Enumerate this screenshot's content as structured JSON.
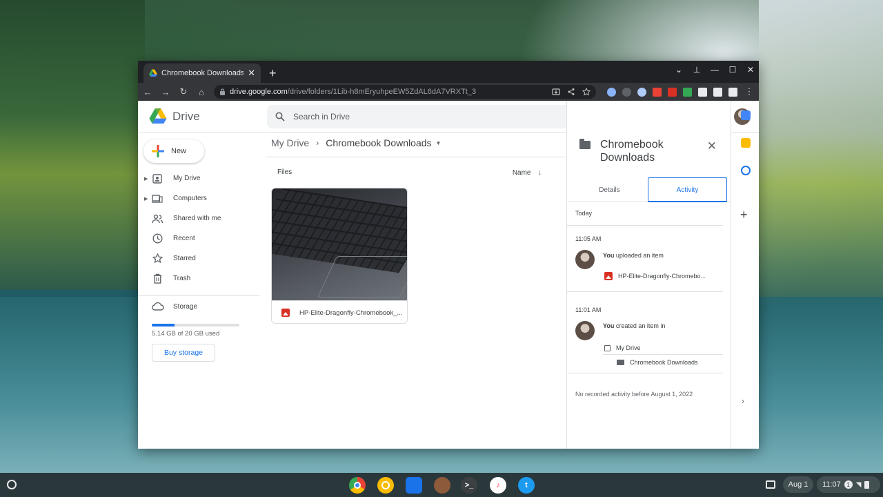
{
  "browser": {
    "tab_title": "Chromebook Downloads - Google Drive",
    "tab_close": "✕",
    "new_tab": "+",
    "url_host": "drive.google.com",
    "url_path": "/drive/folders/1Lib-h8mEryuhpeEW5ZdAL6dA7VRXTt_3",
    "window_controls": [
      "⌄",
      "⊥",
      "—",
      "☐",
      "✕"
    ],
    "nav": {
      "back": "←",
      "forward": "→",
      "reload": "↻",
      "home": "⌂",
      "menu": "⋮"
    }
  },
  "drive": {
    "logo_text": "Drive",
    "search_placeholder": "Search in Drive",
    "new_label": "New",
    "nav_items": [
      {
        "label": "My Drive",
        "icon": "my-drive-icon",
        "caret": true
      },
      {
        "label": "Computers",
        "icon": "computer-icon",
        "caret": true
      },
      {
        "label": "Shared with me",
        "icon": "people-icon",
        "caret": false
      },
      {
        "label": "Recent",
        "icon": "clock-icon",
        "caret": false
      },
      {
        "label": "Starred",
        "icon": "star-icon",
        "caret": false
      },
      {
        "label": "Trash",
        "icon": "trash-icon",
        "caret": false
      }
    ],
    "storage": {
      "label": "Storage",
      "used_text": "5.14 GB of 20 GB used",
      "used_fraction": 0.257,
      "buy_label": "Buy storage"
    },
    "breadcrumb": {
      "root": "My Drive",
      "separator": "›",
      "current": "Chromebook Downloads"
    },
    "files_label": "Files",
    "sort_label": "Name",
    "file": {
      "name": "HP-Elite-Dragonfly-Chromebook_..."
    },
    "details_panel": {
      "title": "Chromebook Downloads",
      "tabs": [
        "Details",
        "Activity"
      ],
      "active_tab": "Activity",
      "today": "Today",
      "activities": [
        {
          "time": "11:05 AM",
          "actor": "You",
          "action": "uploaded an item",
          "item": "HP-Elite-Dragonfly-Chromebo..."
        },
        {
          "time": "11:01 AM",
          "actor": "You",
          "action": "created an item in",
          "location": "My Drive",
          "item": "Chromebook Downloads"
        }
      ],
      "footer": "No recorded activity before August 1, 2022"
    }
  },
  "shelf": {
    "date": "Aug 1",
    "time": "11:07",
    "notification_count": "1"
  },
  "colors": {
    "accent": "#1a73e8",
    "titlebar": "#202124",
    "toolbar": "#35363a"
  }
}
